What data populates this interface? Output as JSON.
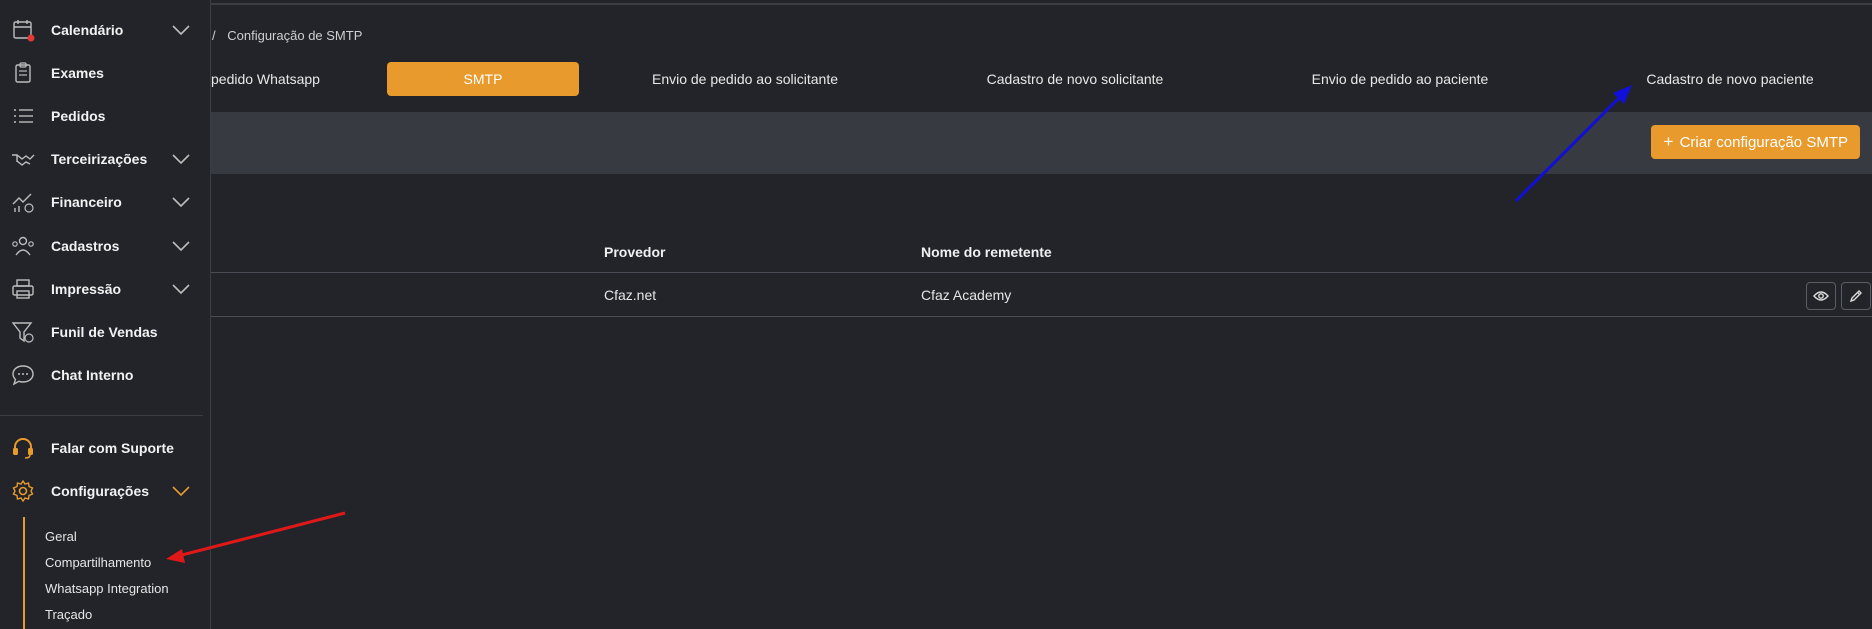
{
  "breadcrumb": {
    "separator": "/",
    "current": "Configuração de SMTP"
  },
  "tabs": [
    {
      "label": "pedido Whatsapp",
      "active": false
    },
    {
      "label": "SMTP",
      "active": true
    },
    {
      "label": "Envio de pedido ao solicitante",
      "active": false
    },
    {
      "label": "Cadastro de novo solicitante",
      "active": false
    },
    {
      "label": "Envio de pedido ao paciente",
      "active": false
    },
    {
      "label": "Cadastro de novo paciente",
      "active": false
    }
  ],
  "toolbar": {
    "create_icon": "plus-icon",
    "create_label": "Criar configuração SMTP"
  },
  "table": {
    "columns": [
      "Provedor",
      "Nome do remetente"
    ],
    "rows": [
      {
        "provider": "Cfaz.net",
        "sender": "Cfaz Academy"
      }
    ],
    "row_actions": [
      "eye-icon",
      "pencil-icon"
    ]
  },
  "sidebar": {
    "items": [
      {
        "label": "Calendário",
        "icon": "calendar-icon",
        "expandable": true
      },
      {
        "label": "Exames",
        "icon": "clipboard-icon",
        "expandable": false
      },
      {
        "label": "Pedidos",
        "icon": "list-icon",
        "expandable": false
      },
      {
        "label": "Terceirizações",
        "icon": "handshake-icon",
        "expandable": true
      },
      {
        "label": "Financeiro",
        "icon": "finance-chart-icon",
        "expandable": true
      },
      {
        "label": "Cadastros",
        "icon": "users-icon",
        "expandable": true
      },
      {
        "label": "Impressão",
        "icon": "printer-icon",
        "expandable": true
      },
      {
        "label": "Funil de Vendas",
        "icon": "funnel-icon",
        "expandable": false
      },
      {
        "label": "Chat Interno",
        "icon": "chat-icon",
        "expandable": false
      }
    ],
    "support": {
      "label": "Falar com Suporte",
      "icon": "headset-icon"
    },
    "settings": {
      "label": "Configurações",
      "icon": "gear-icon",
      "expanded": true,
      "subitems": [
        "Geral",
        "Compartilhamento",
        "Whatsapp Integration",
        "Traçado"
      ]
    }
  },
  "colors": {
    "accent": "#e89a2c",
    "background": "#22242a",
    "toolbar": "#373a41",
    "text": "#e6e6e6",
    "notification_dot": "#e53935"
  },
  "annotations": [
    {
      "color": "#1010d8",
      "type": "arrow"
    },
    {
      "color": "#e01818",
      "type": "arrow"
    }
  ]
}
